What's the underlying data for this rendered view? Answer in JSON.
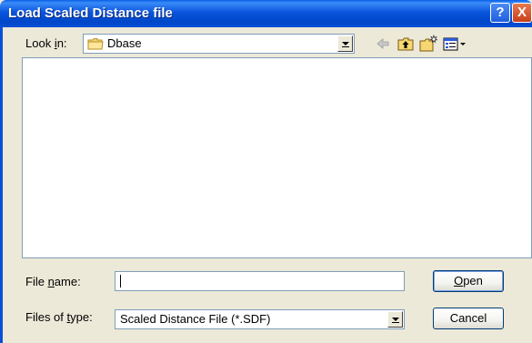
{
  "title": "Load Scaled Distance file",
  "title_buttons": {
    "help": "?",
    "close": "X"
  },
  "look_in": {
    "label_prefix": "Look ",
    "label_accel": "i",
    "label_suffix": "n:",
    "folder": "Dbase",
    "folder_icon": "folder-icon"
  },
  "toolbar": {
    "back_icon": "back-arrow-icon",
    "up_icon": "up-one-level-icon",
    "new_folder_icon": "new-folder-icon",
    "view_icon": "view-menu-icon"
  },
  "file_list": {
    "items": []
  },
  "file_name": {
    "label_prefix": "File ",
    "label_accel": "n",
    "label_suffix": "ame:",
    "value": ""
  },
  "file_type": {
    "label_prefix": "Files of ",
    "label_accel": "t",
    "label_suffix": "ype:",
    "selected": "Scaled Distance File (*.SDF)"
  },
  "buttons": {
    "open_accel": "O",
    "open_rest": "pen",
    "cancel": "Cancel"
  },
  "colors": {
    "titlebar": "#0a55de",
    "dialog_bg": "#ece9d8",
    "field_border": "#7f9db9"
  }
}
